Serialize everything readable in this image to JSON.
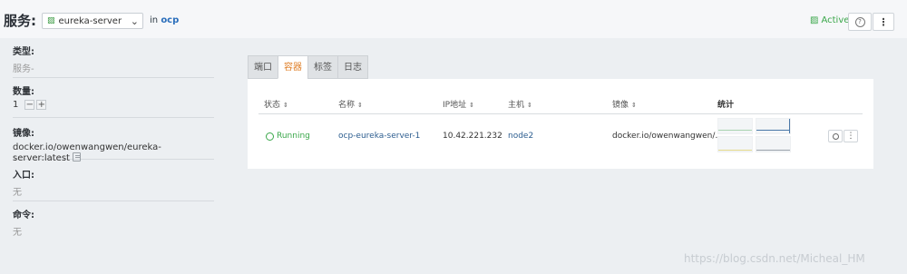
{
  "header": {
    "title": "服务:",
    "service_select": {
      "value": "eureka-server",
      "icon": "stack-icon"
    },
    "in_prefix": "in",
    "environment": "ocp",
    "status": {
      "label": "Active",
      "icon": "stack-icon",
      "color": "#3aa74a"
    },
    "help_icon": "question-icon",
    "more_icon": "vertical-dots-icon"
  },
  "sidebar": {
    "type": {
      "label": "类型:",
      "value": "服务-"
    },
    "scale": {
      "label": "数量:",
      "value": "1",
      "decrement": "−",
      "increment": "+"
    },
    "image": {
      "label": "镜像:",
      "value": "docker.io/owenwangwen/eureka-server:latest"
    },
    "entry": {
      "label": "入口:",
      "value": "无"
    },
    "command": {
      "label": "命令:",
      "value": "无"
    }
  },
  "tabs": [
    {
      "label": "端口",
      "active": false
    },
    {
      "label": "容器",
      "active": true
    },
    {
      "label": "标签",
      "active": false
    },
    {
      "label": "日志",
      "active": false
    }
  ],
  "table": {
    "columns": [
      "状态",
      "名称",
      "IP地址",
      "主机",
      "镜像",
      "统计"
    ],
    "rows": [
      {
        "state": "Running",
        "name": "ocp-eureka-server-1",
        "ip": "10.42.221.232",
        "host": "node2",
        "image": "docker.io/owenwangwen/…"
      }
    ]
  },
  "colors": {
    "accent": "#e0802a",
    "link": "#2c5d8f",
    "success": "#3aa74a"
  },
  "watermark": "https://blog.csdn.net/Micheal_HM"
}
